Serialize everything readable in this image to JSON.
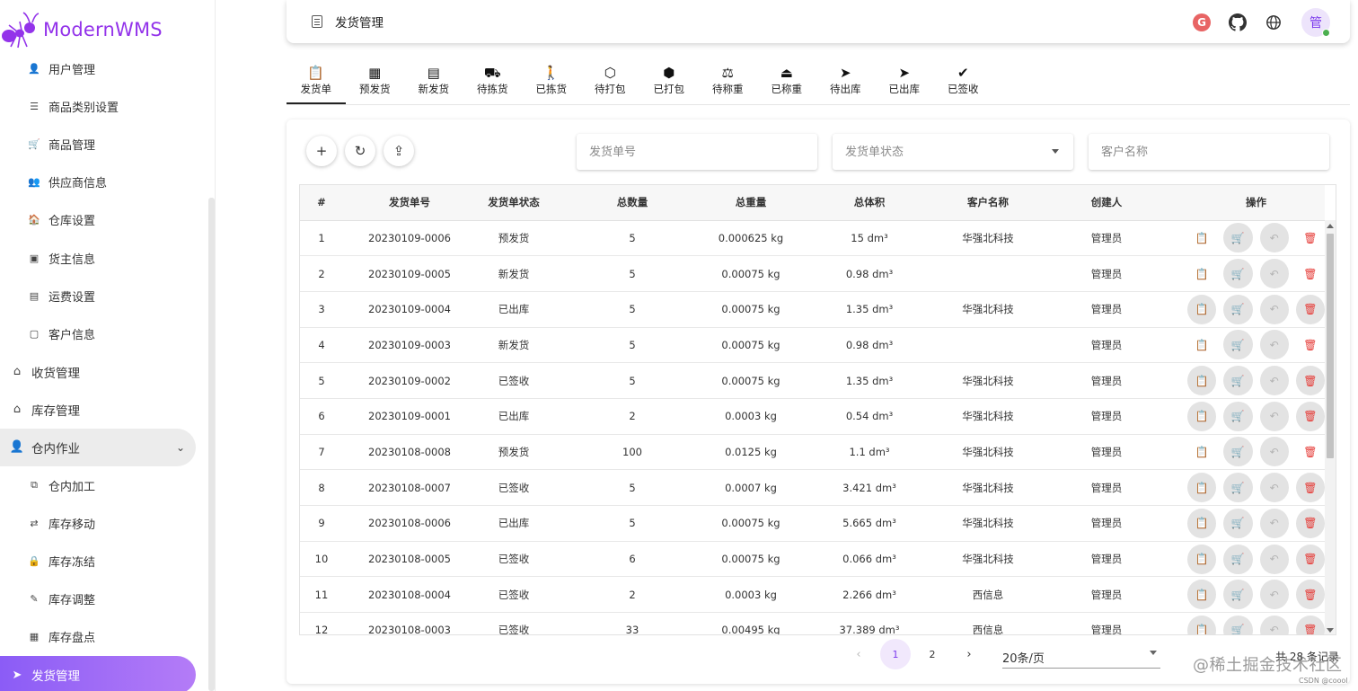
{
  "app": {
    "logo_text": "ModernWMS"
  },
  "sidebar": {
    "items": [
      {
        "label": "用户管理",
        "icon": "person-icon",
        "glyph": "👤",
        "level": "sub"
      },
      {
        "label": "商品类别设置",
        "icon": "list-icon",
        "glyph": "☰",
        "level": "sub"
      },
      {
        "label": "商品管理",
        "icon": "cart-icon",
        "glyph": "🛒",
        "level": "sub"
      },
      {
        "label": "供应商信息",
        "icon": "supplier-icon",
        "glyph": "👥",
        "level": "sub"
      },
      {
        "label": "仓库设置",
        "icon": "warehouse-icon",
        "glyph": "🏠",
        "level": "sub"
      },
      {
        "label": "货主信息",
        "icon": "owner-icon",
        "glyph": "▣",
        "level": "sub"
      },
      {
        "label": "运费设置",
        "icon": "money-icon",
        "glyph": "▤",
        "level": "sub"
      },
      {
        "label": "客户信息",
        "icon": "contact-icon",
        "glyph": "▢",
        "level": "sub"
      },
      {
        "label": "收货管理",
        "icon": "receive-icon",
        "glyph": "⌂",
        "level": "top"
      },
      {
        "label": "库存管理",
        "icon": "stock-icon",
        "glyph": "⌂",
        "level": "top"
      },
      {
        "label": "仓内作业",
        "icon": "worker-icon",
        "glyph": "👤",
        "level": "top",
        "expanded": true
      },
      {
        "label": "仓内加工",
        "icon": "process-icon",
        "glyph": "⧉",
        "level": "sub"
      },
      {
        "label": "库存移动",
        "icon": "move-icon",
        "glyph": "⇄",
        "level": "sub"
      },
      {
        "label": "库存冻结",
        "icon": "lock-icon",
        "glyph": "🔒",
        "level": "sub"
      },
      {
        "label": "库存调整",
        "icon": "adjust-icon",
        "glyph": "✎",
        "level": "sub"
      },
      {
        "label": "库存盘点",
        "icon": "inventory-icon",
        "glyph": "▦",
        "level": "sub"
      },
      {
        "label": "发货管理",
        "icon": "ship-icon",
        "glyph": "➤",
        "level": "top",
        "active": true
      }
    ]
  },
  "header": {
    "title": "发货管理",
    "avatar_text": "管"
  },
  "tabs": [
    {
      "label": "发货单",
      "glyph": "📋",
      "icon": "clipboard-icon",
      "active": true
    },
    {
      "label": "预发货",
      "glyph": "▦",
      "icon": "grid-icon"
    },
    {
      "label": "新发货",
      "glyph": "▤",
      "icon": "list-box-icon"
    },
    {
      "label": "待拣货",
      "glyph": "⛟",
      "icon": "trolley-icon"
    },
    {
      "label": "已拣货",
      "glyph": "🚶",
      "icon": "walker-icon"
    },
    {
      "label": "待打包",
      "glyph": "⬡",
      "icon": "package-icon"
    },
    {
      "label": "已打包",
      "glyph": "⬢",
      "icon": "package-check-icon"
    },
    {
      "label": "待称重",
      "glyph": "⚖",
      "icon": "scale-icon"
    },
    {
      "label": "已称重",
      "glyph": "⏏",
      "icon": "weight-icon"
    },
    {
      "label": "待出库",
      "glyph": "➤",
      "icon": "send-outline-icon"
    },
    {
      "label": "已出库",
      "glyph": "➤",
      "icon": "send-icon"
    },
    {
      "label": "已签收",
      "glyph": "✔",
      "icon": "check-circle-icon"
    }
  ],
  "toolbar": {
    "add_glyph": "+",
    "refresh_glyph": "↻",
    "export_glyph": "⇪"
  },
  "filters": {
    "order_no_placeholder": "发货单号",
    "status_placeholder": "发货单状态",
    "customer_placeholder": "客户名称"
  },
  "table": {
    "columns": [
      "#",
      "发货单号",
      "发货单状态",
      "总数量",
      "总重量",
      "总体积",
      "客户名称",
      "创建人",
      "操作"
    ],
    "rows": [
      {
        "idx": "1",
        "no": "20230109-0006",
        "status": "预发货",
        "qty": "5",
        "weight": "0.000625 kg",
        "volume": "15 dm³",
        "customer": "华强北科技",
        "creator": "管理员",
        "enabled": true
      },
      {
        "idx": "2",
        "no": "20230109-0005",
        "status": "新发货",
        "qty": "5",
        "weight": "0.00075 kg",
        "volume": "0.98 dm³",
        "customer": "",
        "creator": "管理员",
        "enabled": true
      },
      {
        "idx": "3",
        "no": "20230109-0004",
        "status": "已出库",
        "qty": "5",
        "weight": "0.00075 kg",
        "volume": "1.35 dm³",
        "customer": "华强北科技",
        "creator": "管理员",
        "enabled": false
      },
      {
        "idx": "4",
        "no": "20230109-0003",
        "status": "新发货",
        "qty": "5",
        "weight": "0.00075 kg",
        "volume": "0.98 dm³",
        "customer": "",
        "creator": "管理员",
        "enabled": true
      },
      {
        "idx": "5",
        "no": "20230109-0002",
        "status": "已签收",
        "qty": "5",
        "weight": "0.00075 kg",
        "volume": "1.35 dm³",
        "customer": "华强北科技",
        "creator": "管理员",
        "enabled": false
      },
      {
        "idx": "6",
        "no": "20230109-0001",
        "status": "已出库",
        "qty": "2",
        "weight": "0.0003 kg",
        "volume": "0.54 dm³",
        "customer": "华强北科技",
        "creator": "管理员",
        "enabled": false
      },
      {
        "idx": "7",
        "no": "20230108-0008",
        "status": "预发货",
        "qty": "100",
        "weight": "0.0125 kg",
        "volume": "1.1 dm³",
        "customer": "华强北科技",
        "creator": "管理员",
        "enabled": true
      },
      {
        "idx": "8",
        "no": "20230108-0007",
        "status": "已签收",
        "qty": "5",
        "weight": "0.0007 kg",
        "volume": "3.421 dm³",
        "customer": "华强北科技",
        "creator": "管理员",
        "enabled": false
      },
      {
        "idx": "9",
        "no": "20230108-0006",
        "status": "已出库",
        "qty": "5",
        "weight": "0.00075 kg",
        "volume": "5.665 dm³",
        "customer": "华强北科技",
        "creator": "管理员",
        "enabled": false
      },
      {
        "idx": "10",
        "no": "20230108-0005",
        "status": "已签收",
        "qty": "6",
        "weight": "0.00075 kg",
        "volume": "0.066 dm³",
        "customer": "华强北科技",
        "creator": "管理员",
        "enabled": false
      },
      {
        "idx": "11",
        "no": "20230108-0004",
        "status": "已签收",
        "qty": "2",
        "weight": "0.0003 kg",
        "volume": "2.266 dm³",
        "customer": "西信息",
        "creator": "管理员",
        "enabled": false
      },
      {
        "idx": "12",
        "no": "20230108-0003",
        "status": "已签收",
        "qty": "33",
        "weight": "0.00495 kg",
        "volume": "37.389 dm³",
        "customer": "西信息",
        "creator": "管理员",
        "enabled": false
      }
    ],
    "op_glyphs": {
      "confirm": "📋",
      "cart": "🛒",
      "undo": "↶",
      "delete": "🗑"
    }
  },
  "pagination": {
    "prev": "‹",
    "next": "›",
    "pages": [
      "1",
      "2"
    ],
    "current": "1",
    "per_page": "20条/页",
    "total": "共 28 条记录"
  },
  "watermark": {
    "text": "@稀土掘金技术社区",
    "small": "CSDN @coool"
  }
}
